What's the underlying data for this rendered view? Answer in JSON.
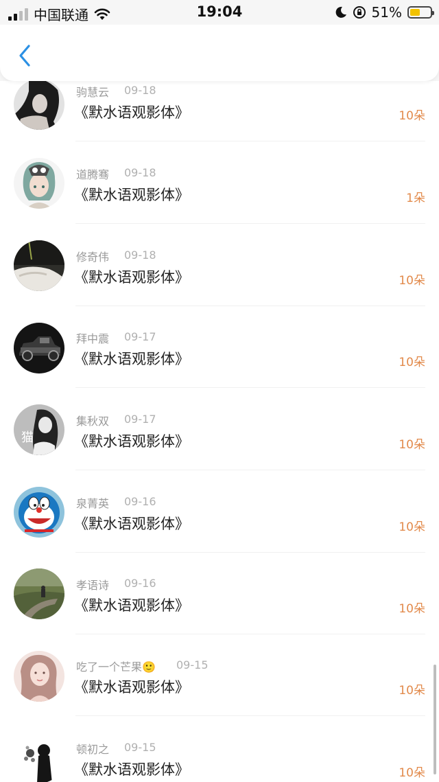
{
  "status_bar": {
    "carrier": "中国联通",
    "time": "19:04",
    "battery": "51%",
    "battery_level": 0.51
  },
  "header": {
    "back_icon": "chevron-left-icon",
    "accent_color": "#2b90e4"
  },
  "records": [
    {
      "name": "驹慧云",
      "date": "09-18",
      "title": "《默水语观影体》",
      "amount": "10朵"
    },
    {
      "name": "道腾骞",
      "date": "09-18",
      "title": "《默水语观影体》",
      "amount": "1朵"
    },
    {
      "name": "修奇伟",
      "date": "09-18",
      "title": "《默水语观影体》",
      "amount": "10朵"
    },
    {
      "name": "拜中震",
      "date": "09-17",
      "title": "《默水语观影体》",
      "amount": "10朵"
    },
    {
      "name": "集秋双",
      "date": "09-17",
      "title": "《默水语观影体》",
      "amount": "10朵"
    },
    {
      "name": "泉菁英",
      "date": "09-16",
      "title": "《默水语观影体》",
      "amount": "10朵"
    },
    {
      "name": "孝语诗",
      "date": "09-16",
      "title": "《默水语观影体》",
      "amount": "10朵"
    },
    {
      "name": "吃了一个芒果🙂",
      "date": "09-15",
      "title": "《默水语观影体》",
      "amount": "10朵"
    },
    {
      "name": "顿初之",
      "date": "09-15",
      "title": "《默水语观影体》",
      "amount": "10朵"
    }
  ],
  "avatar_overlay_text": "猫",
  "colors": {
    "amount": "#e28a4b",
    "name": "#9a9a9a",
    "title": "#222222"
  }
}
